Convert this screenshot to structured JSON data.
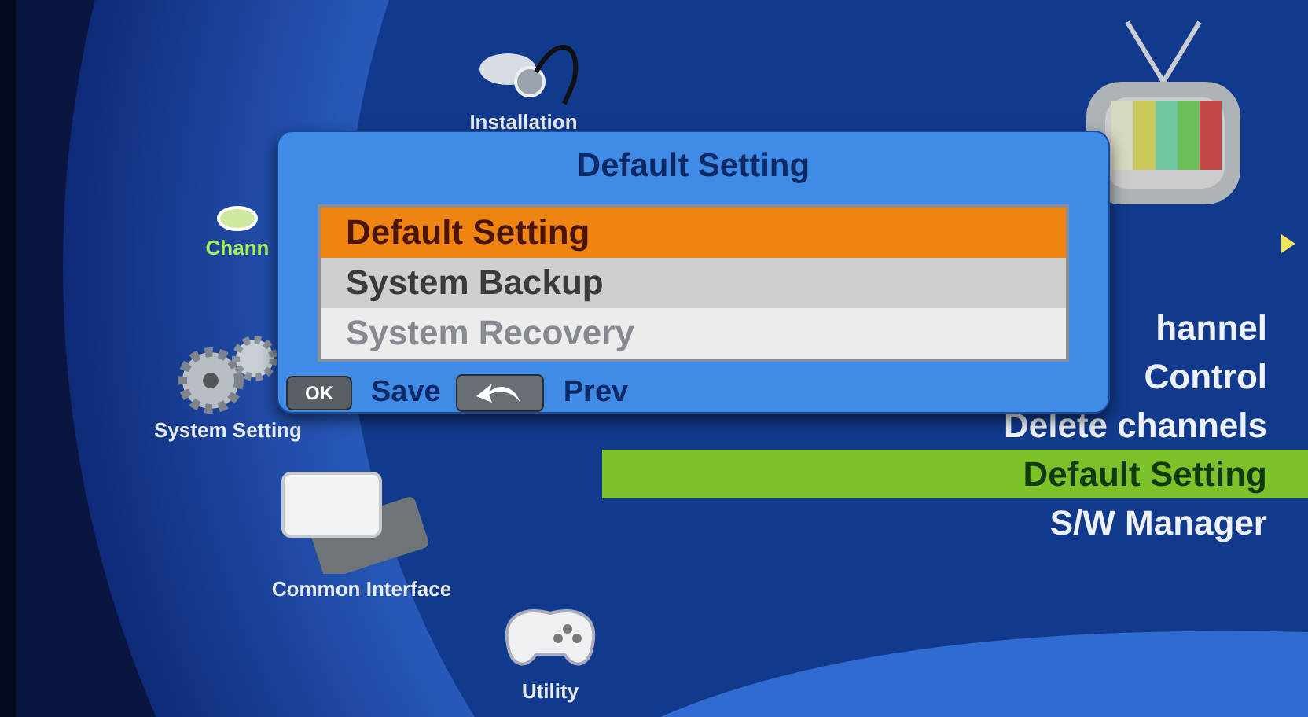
{
  "main_menu": [
    {
      "label": "Installation",
      "selected": false
    },
    {
      "label": "Chann",
      "selected": true
    },
    {
      "label": "System Setting",
      "selected": false
    },
    {
      "label": "Common Interface",
      "selected": false
    },
    {
      "label": "Utility",
      "selected": false
    }
  ],
  "submenu": [
    {
      "label": "hannel",
      "selected": false
    },
    {
      "label": "Control",
      "selected": false
    },
    {
      "label": "Delete channels",
      "selected": false
    },
    {
      "label": "Default Setting",
      "selected": true
    },
    {
      "label": "S/W Manager",
      "selected": false
    }
  ],
  "dialog": {
    "title": "Default Setting",
    "options": [
      {
        "label": "Default Setting",
        "selected": true,
        "disabled": false
      },
      {
        "label": "System Backup",
        "selected": false,
        "disabled": false
      },
      {
        "label": "System Recovery",
        "selected": false,
        "disabled": true
      }
    ],
    "footer": [
      {
        "kind": "text_key",
        "key": "OK",
        "label": "Save"
      },
      {
        "kind": "icon_key",
        "label": "Prev"
      }
    ]
  }
}
